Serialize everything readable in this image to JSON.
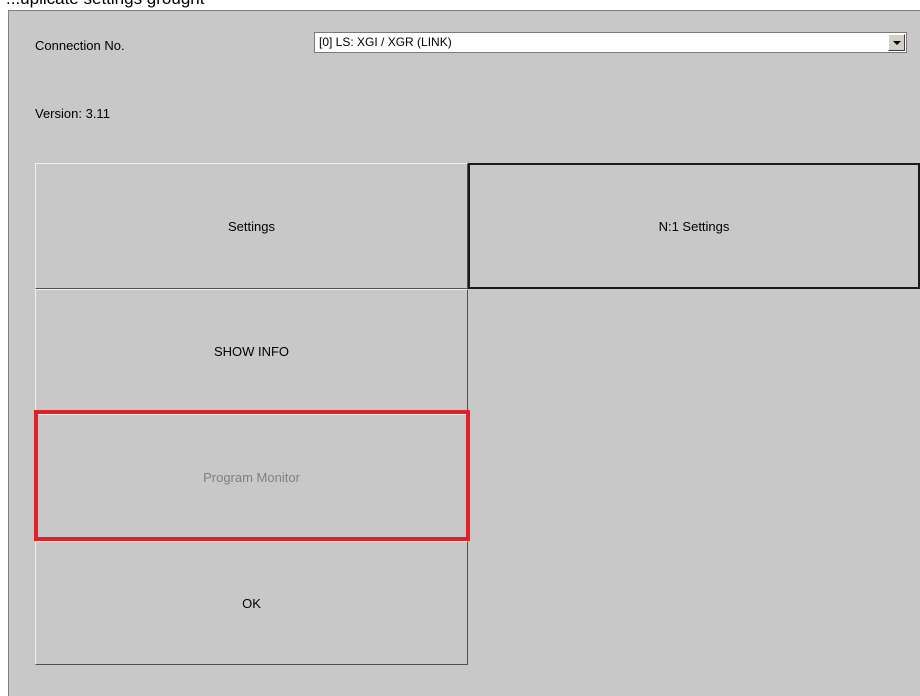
{
  "header": {
    "partial_text": "...uplicate settings grought"
  },
  "connection": {
    "label": "Connection No.",
    "selected": "[0] LS: XGI / XGR (LINK)"
  },
  "version": "Version:  3.11",
  "buttons": {
    "settings": "Settings",
    "n1_settings": "N:1 Settings",
    "show_info": "SHOW INFO",
    "program_monitor": "Program Monitor",
    "ok": "OK"
  },
  "colors": {
    "panel_bg": "#c8c8c8",
    "highlight": "#e0212a",
    "disabled_text": "#808080"
  },
  "icons": {
    "dropdown": "chevron-down-icon"
  }
}
